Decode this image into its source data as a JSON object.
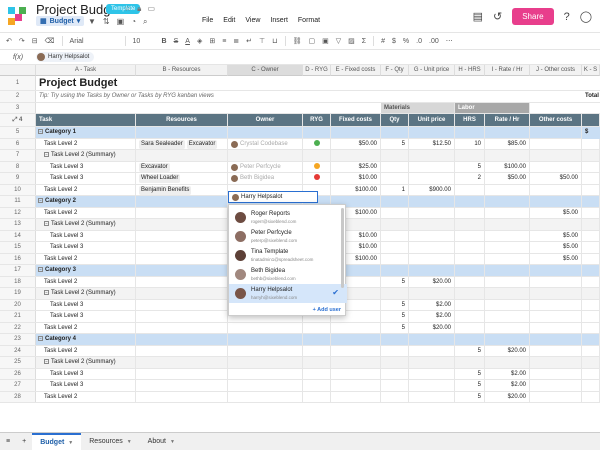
{
  "app": {
    "title": "Project Budget",
    "badge": "Template",
    "sheet_pill": "Budget",
    "menu": [
      "File",
      "Edit",
      "View",
      "Insert",
      "Format"
    ],
    "share_label": "Share"
  },
  "toolbar": {
    "font": "Arial",
    "size": "10",
    "percent": "%",
    "decimals": ".0",
    "decimals2": ".00"
  },
  "formula_bar": {
    "label": "f(x)",
    "value": "Harry Helpsalot"
  },
  "columns": [
    {
      "id": "A",
      "label": "A - Task"
    },
    {
      "id": "B",
      "label": "B - Resources"
    },
    {
      "id": "C",
      "label": "C - Owner"
    },
    {
      "id": "D",
      "label": "D - RYG"
    },
    {
      "id": "E",
      "label": "E - Fixed costs"
    },
    {
      "id": "F",
      "label": "F - Qty"
    },
    {
      "id": "G",
      "label": "G - Unit price"
    },
    {
      "id": "H",
      "label": "H - HRS"
    },
    {
      "id": "I",
      "label": "I - Rate / Hr"
    },
    {
      "id": "J",
      "label": "J - Other costs"
    },
    {
      "id": "K",
      "label": "K - S"
    }
  ],
  "sheet": {
    "title": "Project Budget",
    "tip": "Tip: Try using the Tasks by Owner or Tasks by RYG kanban views",
    "total_label": "Total",
    "materials_label": "Materials",
    "labor_label": "Labor",
    "headers": [
      "Task",
      "Resources",
      "Owner",
      "RYG",
      "Fixed costs",
      "Qty",
      "Unit price",
      "HRS",
      "Rate / Hr",
      "Other costs"
    ],
    "row_dollar": "$"
  },
  "rows": [
    {
      "n": "5",
      "type": "cat",
      "task": "Category 1"
    },
    {
      "n": "6",
      "indent": 1,
      "task": "Task Level 2",
      "res": [
        "Sara Sealeader",
        "Excavator"
      ],
      "owner": "Crystal Codebase",
      "ryg": "#4caf50",
      "fixed": "$50.00",
      "qty": "5",
      "unit": "$12.50",
      "hrs": "10",
      "rate": "$85.00"
    },
    {
      "n": "7",
      "indent": 1,
      "type": "sum",
      "task": "Task Level 2 (Summary)"
    },
    {
      "n": "8",
      "indent": 2,
      "task": "Task Level 3",
      "res": [
        "Excavator"
      ],
      "owner": "Peter Perfcycle",
      "ryg": "#f5a623",
      "fixed": "$25.00",
      "hrs": "5",
      "rate": "$100.00"
    },
    {
      "n": "9",
      "indent": 2,
      "task": "Task Level 3",
      "res": [
        "Wheel Loader"
      ],
      "owner": "Beth Bigidea",
      "ryg": "#e53935",
      "fixed": "$10.00",
      "hrs": "2",
      "rate": "$50.00",
      "other": "$50.00"
    },
    {
      "n": "10",
      "indent": 1,
      "task": "Task Level 2",
      "res": [
        "Benjamin Benefits"
      ],
      "fixed": "$100.00",
      "qty": "1",
      "unit": "$900.00"
    },
    {
      "n": "11",
      "type": "cat",
      "task": "Category 2"
    },
    {
      "n": "12",
      "indent": 1,
      "task": "Task Level 2",
      "fixed": "$100.00",
      "other": "$5.00"
    },
    {
      "n": "13",
      "indent": 1,
      "type": "sum",
      "task": "Task Level 2 (Summary)"
    },
    {
      "n": "14",
      "indent": 2,
      "task": "Task Level 3",
      "fixed": "$10.00",
      "other": "$5.00"
    },
    {
      "n": "15",
      "indent": 2,
      "task": "Task Level 3",
      "fixed": "$10.00",
      "other": "$5.00"
    },
    {
      "n": "16",
      "indent": 1,
      "task": "Task Level 2",
      "fixed": "$100.00",
      "other": "$5.00"
    },
    {
      "n": "17",
      "type": "cat",
      "task": "Category 3"
    },
    {
      "n": "18",
      "indent": 1,
      "task": "Task Level 2",
      "qty": "5",
      "unit": "$20.00"
    },
    {
      "n": "19",
      "indent": 1,
      "type": "sum",
      "task": "Task Level 2 (Summary)"
    },
    {
      "n": "20",
      "indent": 2,
      "task": "Task Level 3",
      "qty": "5",
      "unit": "$2.00"
    },
    {
      "n": "21",
      "indent": 2,
      "task": "Task Level 3",
      "qty": "5",
      "unit": "$2.00"
    },
    {
      "n": "22",
      "indent": 1,
      "task": "Task Level 2",
      "qty": "5",
      "unit": "$20.00"
    },
    {
      "n": "23",
      "type": "cat",
      "task": "Category 4"
    },
    {
      "n": "24",
      "indent": 1,
      "task": "Task Level 2",
      "hrs": "5",
      "rate": "$20.00"
    },
    {
      "n": "25",
      "indent": 1,
      "type": "sum",
      "task": "Task Level 2 (Summary)"
    },
    {
      "n": "26",
      "indent": 2,
      "task": "Task Level 3",
      "hrs": "5",
      "rate": "$2.00"
    },
    {
      "n": "27",
      "indent": 2,
      "task": "Task Level 3",
      "hrs": "5",
      "rate": "$2.00"
    },
    {
      "n": "28",
      "indent": 1,
      "task": "Task Level 2",
      "hrs": "5",
      "rate": "$20.00"
    }
  ],
  "owner_editor": {
    "value": "Harry Helpsalot"
  },
  "dropdown": {
    "users": [
      {
        "name": "Roger Reports",
        "email": "rogerr@sixeblend.com",
        "color": "#6d4c41"
      },
      {
        "name": "Peter Perfcycle",
        "email": "peterp@sixeblend.com",
        "color": "#8d6e63"
      },
      {
        "name": "Tina Template",
        "email": "tinatadmin1@spreadsheet.com",
        "color": "#5d4037"
      },
      {
        "name": "Beth Bigidea",
        "email": "bethb@sixeblend.com",
        "color": "#a1887f"
      },
      {
        "name": "Harry Helpsalot",
        "email": "harryh@sixeblend.com",
        "color": "#795548",
        "selected": true
      }
    ],
    "add_user": "+ Add user"
  },
  "tabs": [
    {
      "label": "Budget",
      "active": true
    },
    {
      "label": "Resources"
    },
    {
      "label": "About"
    }
  ]
}
